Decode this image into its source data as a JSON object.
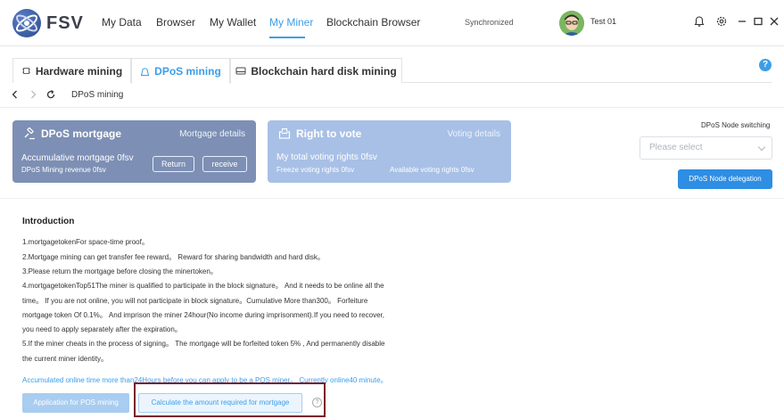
{
  "app": {
    "name": "FSV"
  },
  "nav": {
    "items": [
      {
        "label": "My Data"
      },
      {
        "label": "Browser"
      },
      {
        "label": "My Wallet"
      },
      {
        "label": "My Miner"
      },
      {
        "label": "Blockchain Browser"
      }
    ],
    "active_index": 3
  },
  "status": {
    "sync": "Synchronized",
    "user": "Test 01"
  },
  "topbar_icons": [
    "bell-icon",
    "settings-icon",
    "minimize-icon",
    "maximize-icon",
    "close-icon"
  ],
  "tabs": [
    {
      "label": "Hardware mining",
      "icon": "chip-icon"
    },
    {
      "label": "DPoS mining",
      "icon": "bag-icon"
    },
    {
      "label": "Blockchain hard disk mining",
      "icon": "harddisk-icon"
    }
  ],
  "active_tab": 1,
  "breadcrumb": {
    "label": "DPoS mining"
  },
  "card_mortgage": {
    "title": "DPoS mortgage",
    "link": "Mortgage details",
    "line1": "Accumulative mortgage 0fsv",
    "line2": "DPoS Mining revenue 0fsv",
    "btn_return": "Return",
    "btn_receive": "receive"
  },
  "card_vote": {
    "title": "Right to vote",
    "link": "Voting details",
    "line1": "My total voting rights 0fsv",
    "line2a": "Freeze voting rights 0fsv",
    "line2b": "Available voting rights 0fsv"
  },
  "node": {
    "title": "DPoS Node switching",
    "placeholder": "Please select",
    "button": "DPoS Node delegation"
  },
  "intro": {
    "title": "Introduction",
    "lines": [
      "1.mortgagetokenFor space-time proof。",
      "2.Mortgage mining can get transfer fee reward。 Reward for sharing bandwidth and hard disk。",
      "3.Please return the mortgage before closing the minertoken。",
      "4.mortgagetokenTop51The miner is qualified to participate in the block signature。 And it needs to be online all the",
      "time。 If you are not online, you will not participate in block signature。Cumulative More than300。 Forfeiture",
      "mortgage token Of 0.1%。 And imprison the miner 24hour(No income during imprisonment).If you need to recover,",
      "you need to apply separately after the expiration。",
      "5.If the miner cheats in the process of signing。 The mortgage will be forfeited token 5% , And permanently disable",
      "the current miner identity。"
    ],
    "accumulated": "Accumulated online time more than24Hours before you can apply to be a POS miner。 Currently online40 minute。"
  },
  "actions": {
    "apply": "Application for POS mining",
    "calculate": "Calculate the amount required for mortgage",
    "help": "?"
  }
}
